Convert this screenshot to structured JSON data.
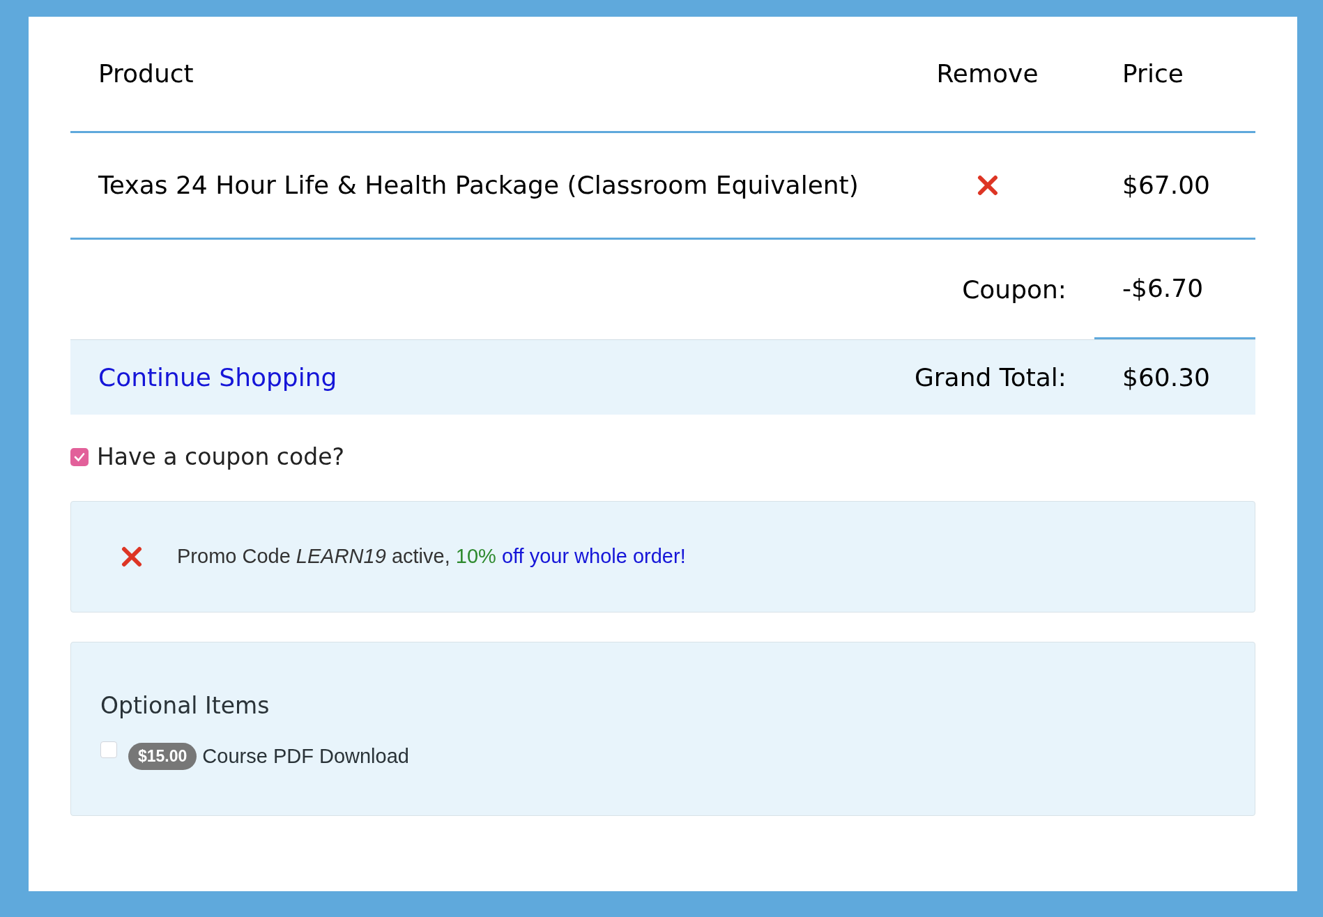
{
  "cart": {
    "columns": [
      "Product",
      "Remove",
      "Price"
    ],
    "rows": [
      {
        "product": "Texas 24 Hour Life & Health Package (Classroom Equivalent)",
        "price": "$67.00"
      }
    ],
    "coupon": {
      "label": "Coupon:",
      "value": "-$6.70"
    },
    "continue_link": "Continue Shopping",
    "grand_total": {
      "label": "Grand Total:",
      "value": "$60.30"
    }
  },
  "coupon_toggle": {
    "label": "Have a coupon code?",
    "checked": true
  },
  "promo": {
    "text": "Promo Code *LEARN19* active,",
    "percent": "10%",
    "tail": "off your whole order!"
  },
  "optional_items": {
    "title": "Optional Items",
    "items": [
      {
        "price": "$15.00",
        "label": "Course PDF Download",
        "checked": false
      }
    ]
  }
}
